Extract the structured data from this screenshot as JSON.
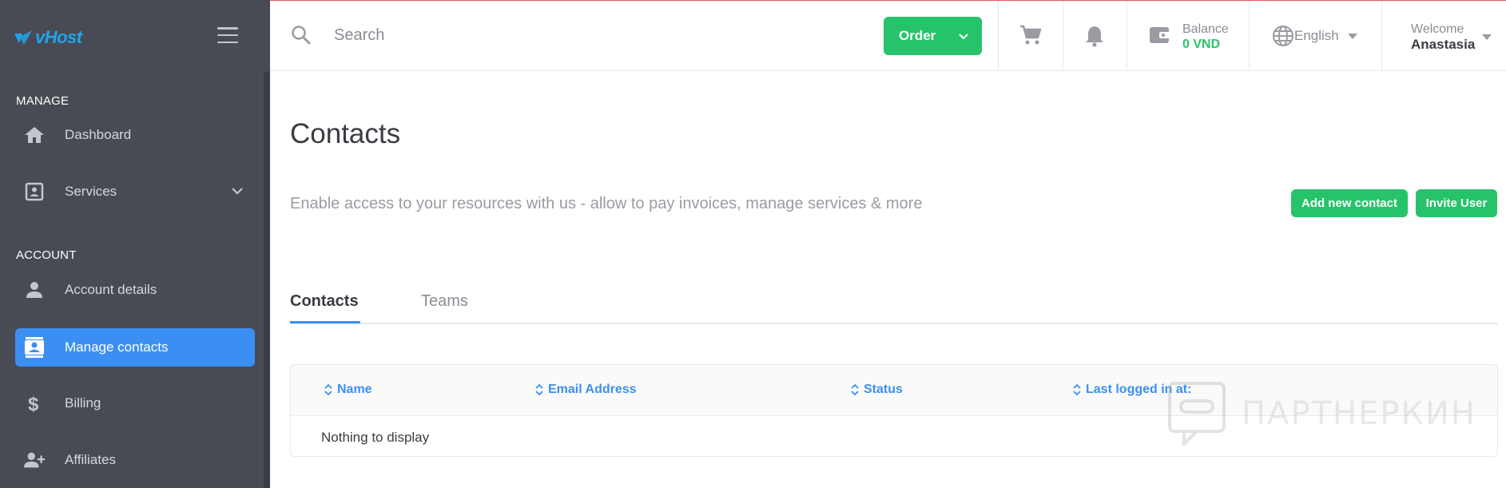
{
  "app": {
    "logo_text": "vHost",
    "accent": "#3b8ff3",
    "success": "#27c36a"
  },
  "sidebar": {
    "sections": [
      {
        "label": "MANAGE"
      },
      {
        "label": "ACCOUNT"
      }
    ],
    "items": [
      {
        "label": "Dashboard",
        "icon": "home-icon"
      },
      {
        "label": "Services",
        "icon": "services-icon"
      },
      {
        "label": "Account details",
        "icon": "person-icon"
      },
      {
        "label": "Manage contacts",
        "icon": "contacts-icon",
        "active": true
      },
      {
        "label": "Billing",
        "icon": "dollar-icon"
      },
      {
        "label": "Affiliates",
        "icon": "affiliates-icon"
      }
    ]
  },
  "topbar": {
    "search_placeholder": "Search",
    "order_label": "Order",
    "balance_label": "Balance",
    "balance_value": "0 VND",
    "language": "English",
    "welcome_label": "Welcome",
    "user_name": "Anastasia"
  },
  "main": {
    "title": "Contacts",
    "subtitle": "Enable access to your resources with us - allow to pay invoices, manage services & more",
    "add_contact_label": "Add new contact",
    "invite_user_label": "Invite User",
    "tabs": [
      {
        "label": "Contacts",
        "active": true
      },
      {
        "label": "Teams",
        "active": false
      }
    ],
    "table": {
      "columns": [
        "Name",
        "Email Address",
        "Status",
        "Last logged in at:"
      ],
      "empty_message": "Nothing to display"
    }
  },
  "watermark": {
    "text": "ПАРТНЕРКИН"
  }
}
